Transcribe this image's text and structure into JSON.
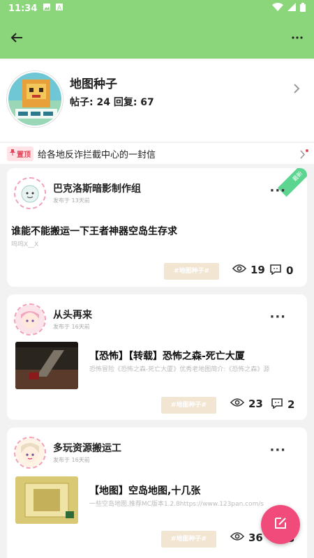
{
  "status": {
    "time": "11:34",
    "icons": [
      "image-icon",
      "a-icon",
      "wifi-icon",
      "signal-icon",
      "battery-icon"
    ]
  },
  "appbar": {
    "back_icon": "arrow-left-icon",
    "more_icon": "more-dots-icon"
  },
  "forum": {
    "title": "地图种子",
    "stats": "帖子: 24 回复: 67"
  },
  "pinned": {
    "badge": "置顶",
    "text": "给各地反诈拦截中心的一封信"
  },
  "posts": [
    {
      "author": "巴克洛斯暗影制作组",
      "time": "发布于 13天前",
      "title": "谁能不能搬运一下王者神器空岛生存求",
      "excerpt": "呜呜X__X",
      "tag": "#地图种子#",
      "views": "19",
      "comments": "0",
      "badge": "最新"
    },
    {
      "author": "从头再来",
      "time": "发布于 16天前",
      "title": "【恐怖】【转载】恐怖之森-死亡大厦",
      "excerpt": "恐怖冒险《恐怖之森-死亡大厦》优秀老地图简介:《恐怖之森》源",
      "tag": "#地图种子#",
      "views": "23",
      "comments": "2"
    },
    {
      "author": "多玩资源搬运工",
      "time": "发布于 16天前",
      "title": "【地图】空岛地图,十几张",
      "excerpt": "一些空岛地图,推荐MC版本1.2.8https://www.123pan.com/s",
      "tag": "#地图种子#",
      "views": "36",
      "comments": "3"
    }
  ],
  "colors": {
    "appbar": "#8bd67b",
    "accent": "#f14b7b",
    "tag_bg": "#f2e5d2",
    "new_badge": "#5bd58f"
  }
}
